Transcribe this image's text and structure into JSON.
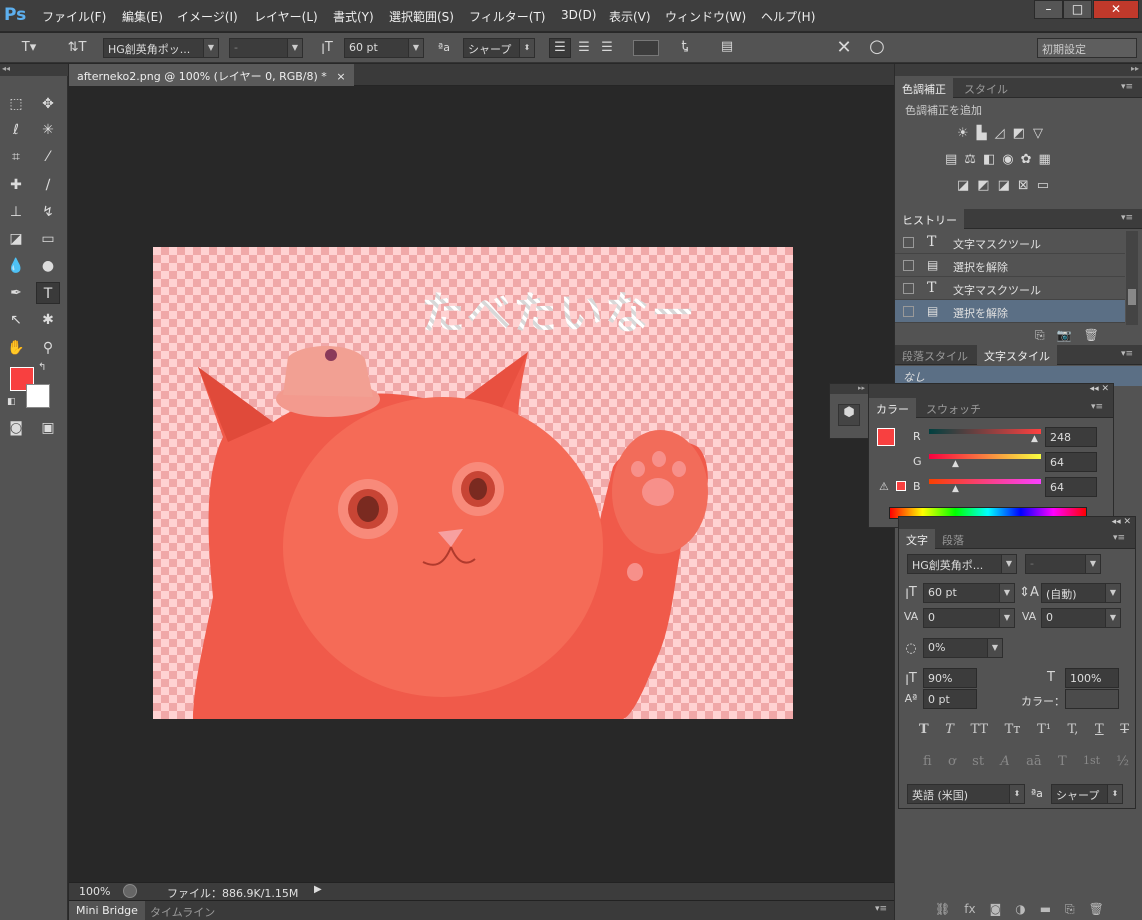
{
  "app": {
    "logo": "Ps"
  },
  "menu": [
    "ファイル(F)",
    "編集(E)",
    "イメージ(I)",
    "レイヤー(L)",
    "書式(Y)",
    "選択範囲(S)",
    "フィルター(T)",
    "3D(D)",
    "表示(V)",
    "ウィンドウ(W)",
    "ヘルプ(H)"
  ],
  "window_controls": [
    "–",
    "□",
    "✕"
  ],
  "options": {
    "font_family": "HG創英角ポッ...",
    "font_style": "-",
    "font_size": "60 pt",
    "antialias": "シャープ",
    "workspace": "初期設定"
  },
  "document": {
    "tab_title": "afterneko2.png @ 100% (レイヤー 0, RGB/8) *",
    "close": "×",
    "overlay_text": "たべたいなー"
  },
  "status": {
    "zoom": "100%",
    "file_info": "ファイル：886.9K/1.15M"
  },
  "bottom_tabs": [
    "Mini Bridge",
    "タイムライン"
  ],
  "adjustments": {
    "tabs": [
      "色調補正",
      "スタイル"
    ],
    "add_label": "色調補正を追加"
  },
  "history": {
    "tab": "ヒストリー",
    "items": [
      {
        "icon": "T",
        "label": "文字マスクツール"
      },
      {
        "icon": "doc",
        "label": "選択を解除"
      },
      {
        "icon": "T",
        "label": "文字マスクツール"
      },
      {
        "icon": "doc",
        "label": "選択を解除"
      }
    ]
  },
  "styles_panel": {
    "tabs": [
      "段落スタイル",
      "文字スタイル"
    ],
    "item": "なし"
  },
  "color_panel": {
    "tabs": [
      "カラー",
      "スウォッチ"
    ],
    "channels": [
      {
        "label": "R",
        "value": "248"
      },
      {
        "label": "G",
        "value": "64"
      },
      {
        "label": "B",
        "value": "64"
      }
    ],
    "foreground": "#f84040"
  },
  "character_panel": {
    "tabs": [
      "文字",
      "段落"
    ],
    "font_family": "HG創英角ポ...",
    "font_style": "-",
    "size": "60 pt",
    "leading": "(自動)",
    "kerning": "0",
    "tracking": "0",
    "tsume": "0%",
    "vscale": "90%",
    "hscale": "100%",
    "baseline": "0 pt",
    "color_label": "カラー：",
    "language": "英語 (米国)",
    "antialias": "シャープ",
    "aa_label": "ªa",
    "style_buttons": [
      "T",
      "T",
      "TT",
      "Tт",
      "T¹",
      "T,",
      "T",
      "T"
    ],
    "opentype_buttons": [
      "ﬁ",
      "ơ",
      "st",
      "A",
      "aā",
      "T",
      "1st",
      "½"
    ]
  }
}
